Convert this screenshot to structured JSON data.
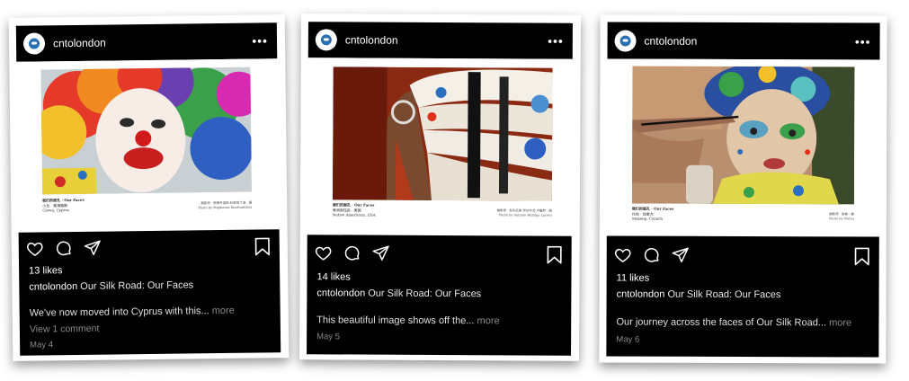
{
  "posts": [
    {
      "username": "cntolondon",
      "caption_title": "我们的面孔 · Our Faces",
      "caption_sub": "小丑 · 塞浦路斯",
      "caption_loc": "Clown, Cyprus",
      "caption_credit_cn": "摄影师 · 斯蒂芬诺斯·科斯坦丁诺 · 摄",
      "caption_credit_en": "Photo by Stephanos Konstantinou",
      "likes": "13 likes",
      "caption_user": "cntolondon",
      "caption_text": "Our Silk Road: Our Faces",
      "description": "We've now moved into Cyprus with this...",
      "more": "more",
      "comments": "View 1 comment",
      "date": "May 4"
    },
    {
      "username": "cntolondon",
      "caption_title": "我们的面孔 · Our Faces",
      "caption_sub": "美洲原住民 · 美国",
      "caption_loc": "Native Americans, USA",
      "caption_credit_cn": "摄影师 · 安东尼奥·伊达尔戈·卢塞罗 · 摄",
      "caption_credit_en": "Photo by Antonio Hidalgo Lucero",
      "likes": "14 likes",
      "caption_user": "cntolondon",
      "caption_text": "Our Silk Road: Our Faces",
      "description": "This beautiful image shows off the...",
      "more": "more",
      "comments": "",
      "date": "May 5"
    },
    {
      "username": "cntolondon",
      "caption_title": "我们的面孔 · Our Faces",
      "caption_sub": "化妆 · 加拿大",
      "caption_loc": "Makeup, Canada",
      "caption_credit_cn": "摄影师 · 斯雷 · 摄",
      "caption_credit_en": "Photo by Slerea",
      "likes": "11 likes",
      "caption_user": "cntolondon",
      "caption_text": "Our Silk Road: Our Faces",
      "description": "Our journey across the faces of Our Silk Road...",
      "more": "more",
      "comments": "",
      "date": "May 6"
    }
  ],
  "icons": [
    "heart-icon",
    "comment-icon",
    "share-icon",
    "bookmark-icon",
    "more-options-icon"
  ],
  "colors": {
    "background": "#ffffff",
    "bar": "#000000",
    "muted": "#8a8a8a",
    "avatar": "#2a6fb0"
  }
}
